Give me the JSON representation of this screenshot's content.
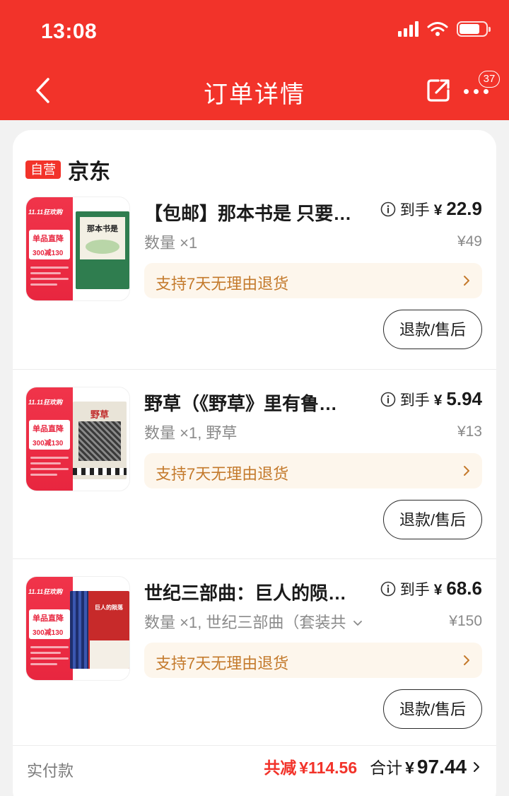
{
  "status_bar": {
    "time": "13:08"
  },
  "nav": {
    "title": "订单详情",
    "badge_count": "37"
  },
  "shop": {
    "tag": "自营",
    "name": "京东"
  },
  "items": [
    {
      "title": "【包邮】那本书是 只要…",
      "price_label": "到手",
      "currency": "¥",
      "price": "22.9",
      "original_price": "¥49",
      "spec": "数量 ×1",
      "return_text": "支持7天无理由退货",
      "refund_label": "退款/售后",
      "cover_title": "那本书是"
    },
    {
      "title": "野草（《野草》里有鲁…",
      "price_label": "到手",
      "currency": "¥",
      "price": "5.94",
      "original_price": "¥13",
      "spec": "数量 ×1, 野草",
      "return_text": "支持7天无理由退货",
      "refund_label": "退款/售后",
      "cover_title": "野草"
    },
    {
      "title": "世纪三部曲：巨人的陨…",
      "price_label": "到手",
      "currency": "¥",
      "price": "68.6",
      "original_price": "¥150",
      "spec": "数量 ×1, 世纪三部曲（套装共",
      "return_text": "支持7天无理由退货",
      "refund_label": "退款/售后",
      "cover_title": "巨人的陨落"
    }
  ],
  "summary": {
    "label": "实付款",
    "saved_label": "共减",
    "saved_amount": "¥114.56",
    "total_label": "合计",
    "total_currency": "¥",
    "total_amount": "97.44"
  },
  "promo": {
    "header": "11.11狂欢购",
    "title": "单品直降",
    "deal": "300减130"
  },
  "colors": {
    "brand_red": "#f2332a",
    "return_bg": "#fdf6ec",
    "return_text": "#c47a2c",
    "muted_text": "#8a8a8a"
  }
}
